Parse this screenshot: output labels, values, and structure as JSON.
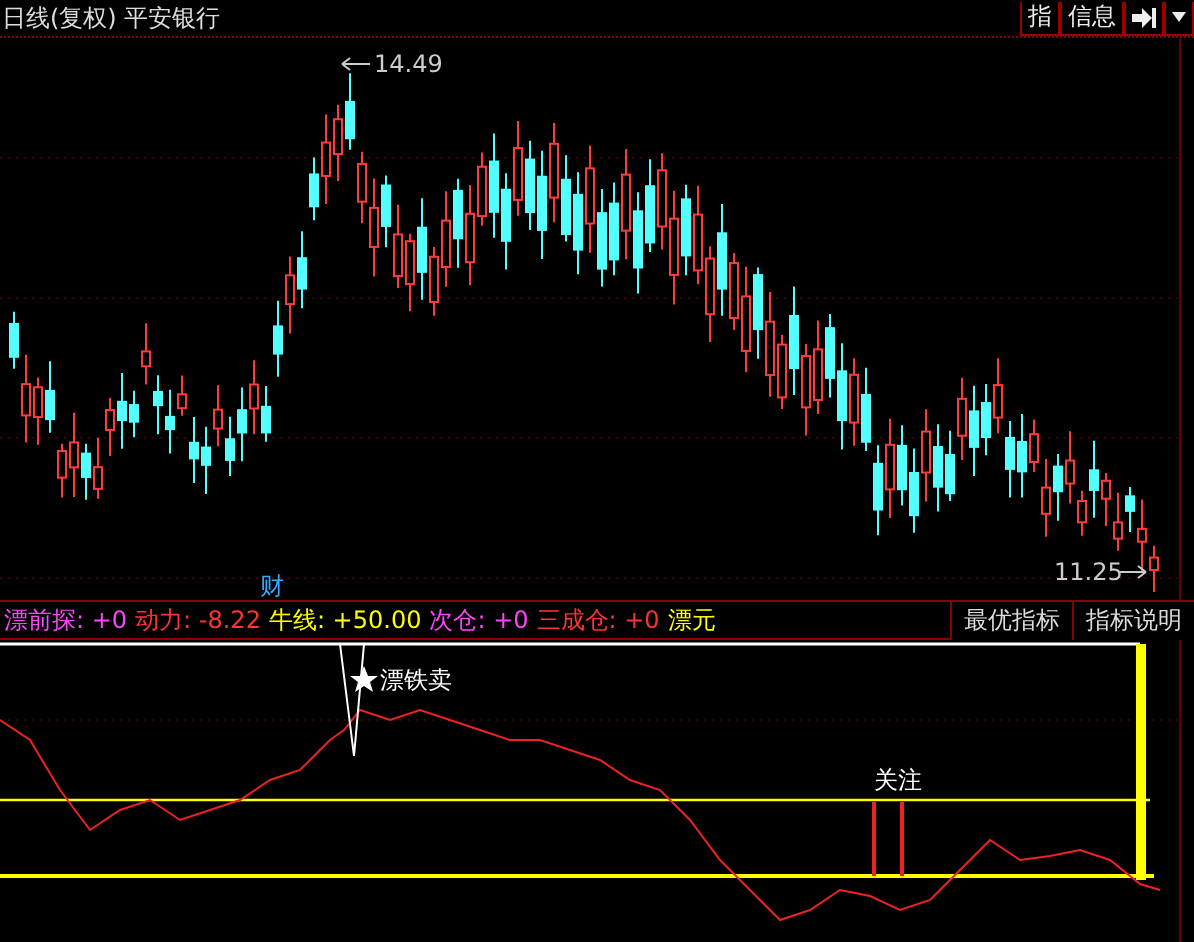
{
  "window": {
    "period": "日线(复权)",
    "stock": "平安银行"
  },
  "toolbar": [
    {
      "kind": "text",
      "label": "指"
    },
    {
      "kind": "text",
      "label": "信息"
    },
    {
      "kind": "arrow"
    },
    {
      "kind": "dropdown"
    }
  ],
  "main_chart": {
    "high_label": "14.49",
    "low_label": "11.25",
    "event_marker": "财"
  },
  "indicator": {
    "readouts": [
      {
        "label": "漂前探:",
        "value": "+0"
      },
      {
        "label": "动力:",
        "value": "-8.22"
      },
      {
        "label": "牛线:",
        "value": "+50.00"
      },
      {
        "label": "次仓:",
        "value": "+0"
      },
      {
        "label": "三成仓:",
        "value": "+0"
      },
      {
        "label": "漂元"
      }
    ],
    "tabs": [
      {
        "label": "最优指标",
        "selected": false
      },
      {
        "label": "指标说明",
        "selected": false
      }
    ],
    "signals": [
      {
        "kind": "sell",
        "label": "漂铁卖"
      },
      {
        "kind": "watch",
        "label": "关注"
      }
    ]
  }
}
